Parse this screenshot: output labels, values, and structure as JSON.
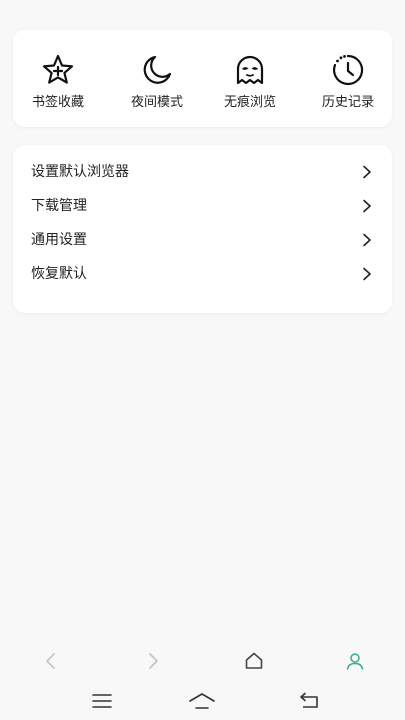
{
  "quick_actions": [
    {
      "label": "书签收藏",
      "icon": "bookmark-star-icon"
    },
    {
      "label": "夜间模式",
      "icon": "moon-icon"
    },
    {
      "label": "无痕浏览",
      "icon": "ghost-icon"
    },
    {
      "label": "历史记录",
      "icon": "history-clock-icon"
    }
  ],
  "settings": [
    {
      "label": "设置默认浏览器"
    },
    {
      "label": "下载管理"
    },
    {
      "label": "通用设置"
    },
    {
      "label": "恢复默认"
    }
  ],
  "bottom_nav": {
    "back_icon": "back-arrow-icon",
    "forward_icon": "forward-arrow-icon",
    "home_icon": "home-icon",
    "profile_icon": "profile-icon"
  },
  "system_nav": {
    "menu_icon": "menu-icon",
    "home_icon": "system-home-icon",
    "back_icon": "system-back-icon"
  },
  "colors": {
    "accent": "#3bb08f",
    "disabled": "#c4c4c4",
    "background": "#f8f8f8"
  }
}
